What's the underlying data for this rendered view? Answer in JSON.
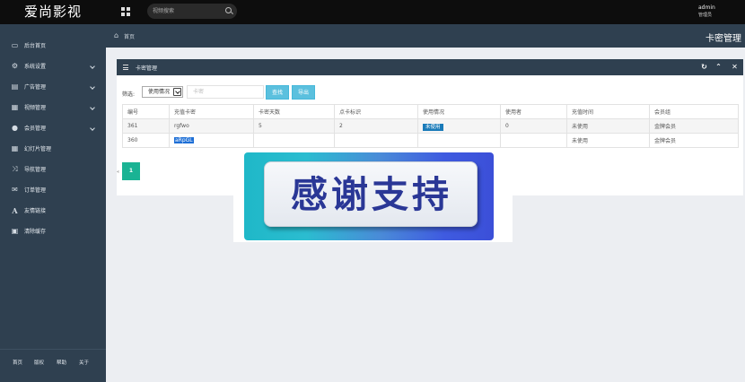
{
  "app": {
    "logo": "爱尚影视"
  },
  "topbar": {
    "search_placeholder": "视频搜索",
    "user_name": "admin",
    "user_role": "管理员"
  },
  "sidebar": {
    "items": [
      {
        "label": "后台首页",
        "icon": "monitor-icon",
        "has_arrow": false
      },
      {
        "label": "系统设置",
        "icon": "settings-icon",
        "has_arrow": true
      },
      {
        "label": "广告管理",
        "icon": "ad-icon",
        "has_arrow": true
      },
      {
        "label": "视频管理",
        "icon": "film-icon",
        "has_arrow": true
      },
      {
        "label": "会员管理",
        "icon": "users-icon",
        "has_arrow": true
      },
      {
        "label": "幻灯片管理",
        "icon": "grid-icon",
        "has_arrow": false
      },
      {
        "label": "导航管理",
        "icon": "shuffle-icon",
        "has_arrow": false
      },
      {
        "label": "订单管理",
        "icon": "envelope-icon",
        "has_arrow": false
      },
      {
        "label": "友情链接",
        "icon": "font-icon",
        "has_arrow": false
      },
      {
        "label": "清除缓存",
        "icon": "calendar-icon",
        "has_arrow": false
      }
    ],
    "footer": [
      "首页",
      "版权",
      "帮助",
      "关于"
    ]
  },
  "breadcrumb": {
    "home": "首页",
    "page_title": "卡密管理"
  },
  "panel": {
    "title": "卡密管理",
    "filter_label": "筛选:",
    "select_value": "使用情况",
    "keyword_placeholder": "卡密",
    "search_button": "查找",
    "export_button": "导出"
  },
  "table": {
    "headers": [
      "编号",
      "充值卡密",
      "卡密天数",
      "点卡标识",
      "使用情况",
      "使用者",
      "充值时间",
      "会员组"
    ],
    "rows": [
      [
        "361",
        "rgfwo",
        "5",
        "2",
        "未使用",
        "0",
        "未使用",
        "金牌会员"
      ],
      [
        "360",
        "aRpGL",
        "",
        "",
        "",
        "",
        "未使用",
        "金牌会员"
      ]
    ]
  },
  "pager": {
    "prev": "«",
    "current": "1"
  },
  "banner": {
    "text": "感谢支持"
  },
  "colors": {
    "sidebar": "#2f4050",
    "topbar": "#0d0d0d",
    "accent": "#1ab394",
    "button": "#5bc0de",
    "tag": "#1a7bb9"
  }
}
